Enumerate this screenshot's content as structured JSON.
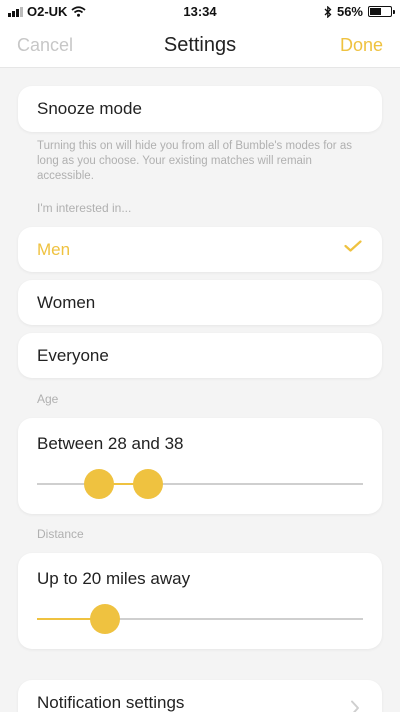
{
  "status_bar": {
    "carrier": "O2-UK",
    "time": "13:34",
    "battery_text": "56%",
    "battery_level": 0.56
  },
  "nav": {
    "cancel_label": "Cancel",
    "title": "Settings",
    "done_label": "Done"
  },
  "snooze": {
    "label": "Snooze mode",
    "description": "Turning this on will hide you from all of Bumble's modes for as long as you choose. Your existing matches will remain accessible."
  },
  "interest": {
    "caption": "I'm interested in...",
    "options": [
      {
        "label": "Men",
        "selected": true
      },
      {
        "label": "Women",
        "selected": false
      },
      {
        "label": "Everyone",
        "selected": false
      }
    ]
  },
  "age": {
    "caption": "Age",
    "label": "Between 28 and 38",
    "range_fraction": [
      0.19,
      0.34
    ]
  },
  "distance": {
    "caption": "Distance",
    "label": "Up to 20 miles away",
    "value_fraction": 0.21
  },
  "notifications": {
    "label": "Notification settings"
  },
  "colors": {
    "accent": "#efc240",
    "muted": "#c7c7c7",
    "background": "#f4f4f4"
  },
  "icons": {
    "check": "checkmark-icon",
    "chevron": "chevron-right-icon",
    "wifi": "wifi-icon",
    "bluetooth": "bluetooth-icon",
    "battery": "battery-icon",
    "signal": "signal-icon"
  }
}
